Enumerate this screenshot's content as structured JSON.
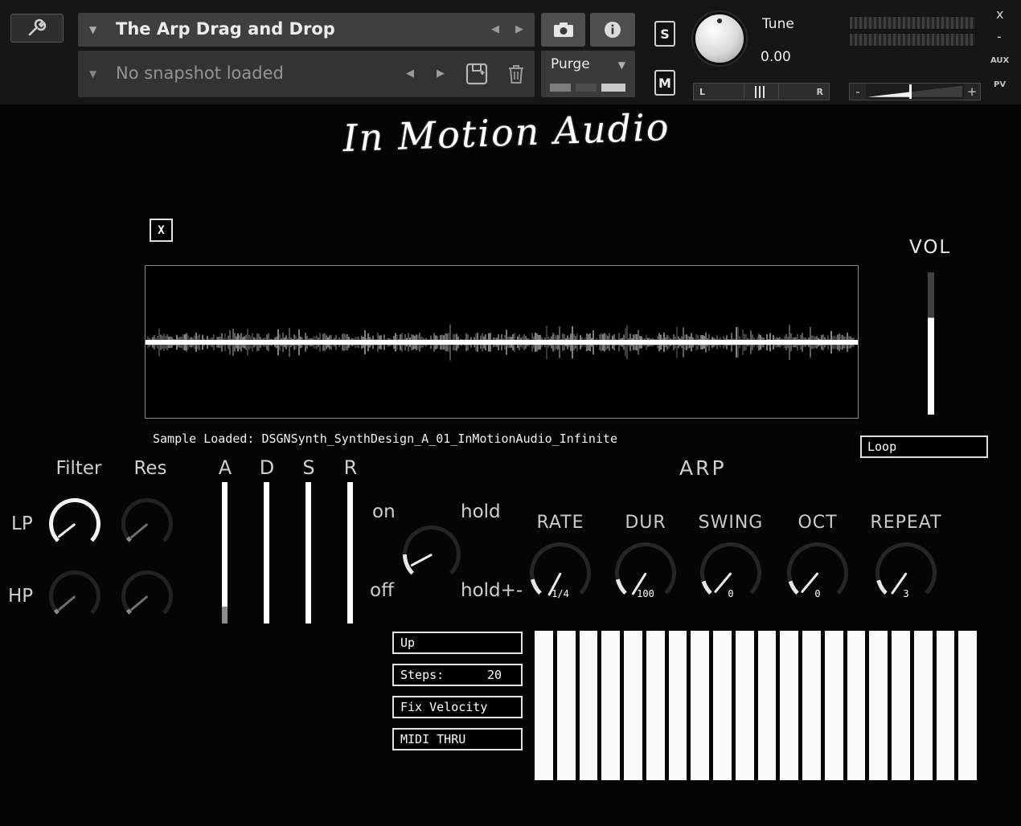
{
  "header": {
    "instrument_title": "The Arp Drag and Drop",
    "snapshot_label": "No snapshot loaded",
    "purge_label": "Purge",
    "solo_label": "S",
    "mute_label": "M",
    "tune_label": "Tune",
    "tune_value": "0.00",
    "pan_left_label": "L",
    "pan_right_label": "R",
    "volume_minus_label": "-",
    "volume_plus_label": "+",
    "window_close_label": "x",
    "window_minimize_label": "-",
    "aux_label": "AUX",
    "pv_label": "PV"
  },
  "icons": {
    "dropdown_glyph": "▼",
    "prev_glyph": "◀",
    "next_glyph": "▶"
  },
  "logo_text": "In Motion Audio",
  "sample_area": {
    "clear_button_label": "X",
    "status_text": "Sample Loaded: DSGNSynth_SynthDesign_A_01_InMotionAudio_Infinite",
    "volume_label": "VOL",
    "loop_button_label": "Loop"
  },
  "filter_section": {
    "filter_label": "Filter",
    "res_label": "Res",
    "lp_label": "LP",
    "hp_label": "HP"
  },
  "envelope": {
    "attack_label": "A",
    "decay_label": "D",
    "sustain_label": "S",
    "release_label": "R"
  },
  "arp_section": {
    "title": "ARP",
    "on_label": "on",
    "off_label": "off",
    "hold_label": "hold",
    "hold_plus_minus_label": "hold+-",
    "knobs": [
      {
        "label": "RATE",
        "value": "1/4"
      },
      {
        "label": "DUR",
        "value": "100"
      },
      {
        "label": "SWING",
        "value": "0"
      },
      {
        "label": "OCT",
        "value": "0"
      },
      {
        "label": "REPEAT",
        "value": "3"
      }
    ],
    "direction_menu": "Up",
    "steps_label": "Steps:",
    "steps_value": "20",
    "velocity_menu": "Fix Velocity",
    "midi_menu": "MIDI THRU",
    "step_count": 20
  },
  "colors": {
    "accent": "#ffffff",
    "header_panel": "#3f3f3f",
    "screen_bg": "#050505"
  }
}
